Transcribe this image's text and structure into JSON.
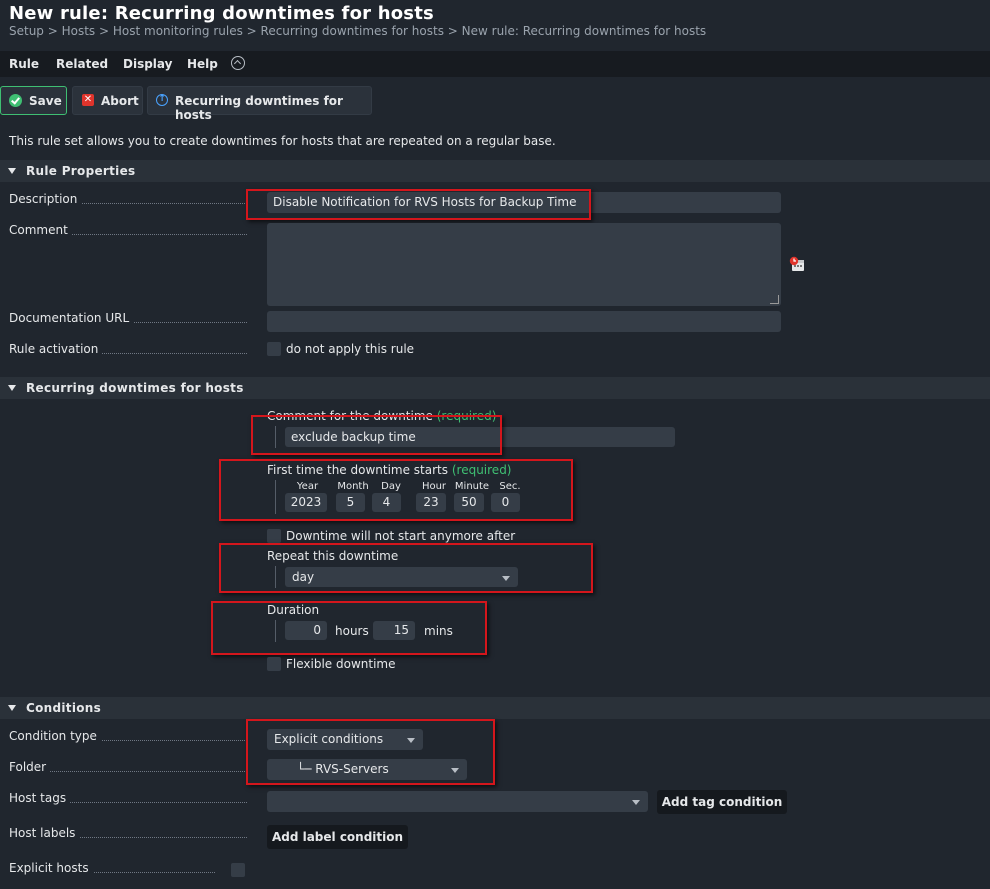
{
  "page": {
    "title": "New rule: Recurring downtimes for hosts",
    "breadcrumb": "Setup > Hosts > Host monitoring rules > Recurring downtimes for hosts > New rule: Recurring downtimes for hosts"
  },
  "menu": {
    "rule": "Rule",
    "related": "Related",
    "display": "Display",
    "help": "Help"
  },
  "toolbar": {
    "save": "Save",
    "abort": "Abort",
    "ruleset": "Recurring downtimes for hosts"
  },
  "intro": "This rule set allows you to create downtimes for hosts that are repeated on a regular base.",
  "rule_properties": {
    "header": "Rule Properties",
    "description_label": "Description",
    "description_value": "Disable Notification for RVS Hosts for Backup Time",
    "comment_label": "Comment",
    "comment_value": "",
    "doc_url_label": "Documentation URL",
    "doc_url_value": "",
    "activation_label": "Rule activation",
    "activation_checkbox": "do not apply this rule"
  },
  "downtimes": {
    "header": "Recurring downtimes for hosts",
    "comment_label": "Comment for the downtime",
    "required": "(required)",
    "comment_value": "exclude backup time",
    "first_time_label": "First time the downtime starts",
    "date_labels": {
      "year": "Year",
      "month": "Month",
      "day": "Day",
      "hour": "Hour",
      "minute": "Minute",
      "sec": "Sec."
    },
    "date_values": {
      "year": "2023",
      "month": "5",
      "day": "4",
      "hour": "23",
      "minute": "50",
      "sec": "0"
    },
    "not_start_after": "Downtime will not start anymore after",
    "repeat_label": "Repeat this downtime",
    "repeat_value": "day",
    "duration_label": "Duration",
    "duration_hours": "0",
    "hours_unit": "hours",
    "duration_mins": "15",
    "mins_unit": "mins",
    "flexible": "Flexible downtime"
  },
  "conditions": {
    "header": "Conditions",
    "condition_type_label": "Condition type",
    "condition_type_value": "Explicit conditions",
    "folder_label": "Folder",
    "folder_value": "└─ RVS-Servers",
    "host_tags_label": "Host tags",
    "host_tags_value": "",
    "add_tag_button": "Add tag condition",
    "host_labels_label": "Host labels",
    "add_label_button": "Add label condition",
    "explicit_hosts_label": "Explicit hosts"
  },
  "colors": {
    "background": "#20262e",
    "accent_green": "#3fbf73",
    "highlight_red": "#d4161c"
  }
}
